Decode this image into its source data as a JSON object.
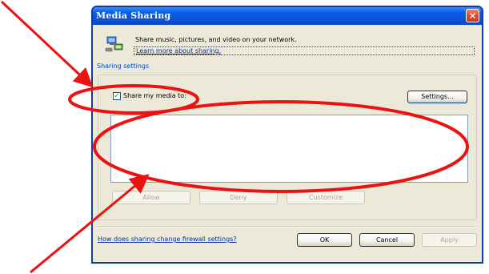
{
  "window": {
    "title": "Media Sharing",
    "close_glyph": "✕"
  },
  "header": {
    "icon": "media-sharing-icon",
    "description": "Share music, pictures, and video on your network.",
    "learn_more_link": "Learn more about sharing."
  },
  "sharing_settings": {
    "group_label": "Sharing settings",
    "share_checkbox": {
      "label": "Share my media to:",
      "checked": true,
      "check_glyph": "✓"
    },
    "settings_button": "Settings...",
    "device_list": [],
    "allow_button": "Allow",
    "deny_button": "Deny",
    "customize_button": "Customize"
  },
  "footer": {
    "firewall_link": "How does sharing change firewall settings?",
    "ok_button": "OK",
    "cancel_button": "Cancel",
    "apply_button": "Apply"
  },
  "colors": {
    "titlebar": "#0a5ee6",
    "dialog_background": "#ece9d8",
    "annotation": "#ee1111",
    "link": "#0a2fa6"
  }
}
